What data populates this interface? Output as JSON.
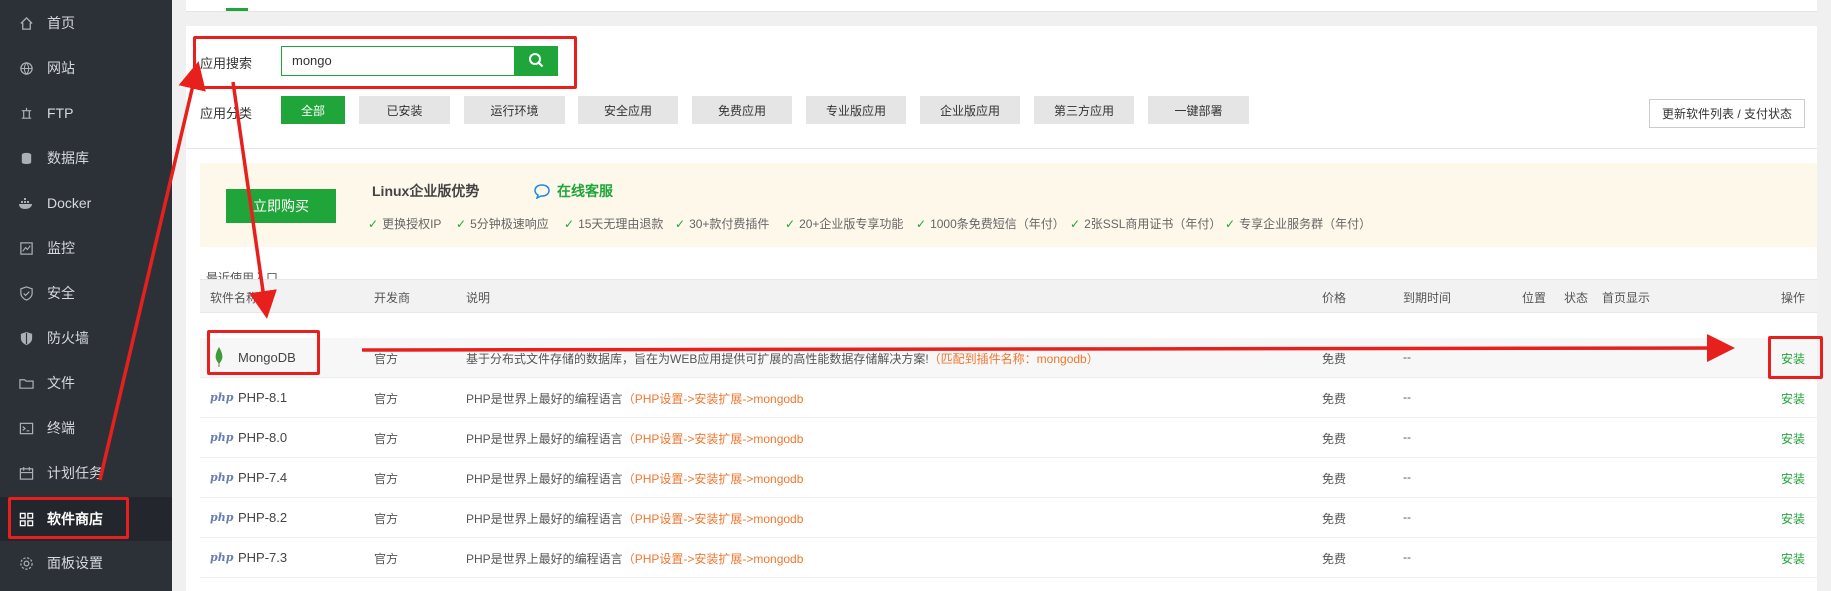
{
  "sidebar": {
    "items": [
      {
        "label": "首页",
        "icon": "home-icon"
      },
      {
        "label": "网站",
        "icon": "globe-icon"
      },
      {
        "label": "FTP",
        "icon": "ftp-icon"
      },
      {
        "label": "数据库",
        "icon": "database-icon"
      },
      {
        "label": "Docker",
        "icon": "docker-icon"
      },
      {
        "label": "监控",
        "icon": "monitor-icon"
      },
      {
        "label": "安全",
        "icon": "shield-icon"
      },
      {
        "label": "防火墙",
        "icon": "firewall-icon"
      },
      {
        "label": "文件",
        "icon": "folder-icon"
      },
      {
        "label": "终端",
        "icon": "terminal-icon"
      },
      {
        "label": "计划任务",
        "icon": "calendar-icon"
      },
      {
        "label": "软件商店",
        "icon": "grid-icon"
      },
      {
        "label": "面板设置",
        "icon": "gear-icon"
      }
    ],
    "active_index": 11
  },
  "search": {
    "label": "应用搜索",
    "value": "mongo"
  },
  "categories": {
    "label": "应用分类",
    "items": [
      "全部",
      "已安装",
      "运行环境",
      "安全应用",
      "免费应用",
      "专业版应用",
      "企业版应用",
      "第三方应用",
      "一键部署"
    ],
    "active_index": 0
  },
  "refresh_label": "更新软件列表 / 支付状态",
  "promo": {
    "buy_label": "立即购买",
    "title": "Linux企业版优势",
    "service_label": "在线客服",
    "features": [
      "更换授权IP",
      "5分钟极速响应",
      "15天无理由退款",
      "30+款付费插件",
      "20+企业版专享功能",
      "1000条免费短信（年付）",
      "2张SSL商用证书（年付）",
      "专享企业服务群（年付）"
    ]
  },
  "recent_label": "最近使用入口",
  "table": {
    "headers": {
      "name": "软件名称",
      "vendor": "开发商",
      "desc": "说明",
      "price": "价格",
      "expire": "到期时间",
      "position": "位置",
      "status": "状态",
      "home": "首页显示",
      "action": "操作"
    },
    "rows": [
      {
        "name": "MongoDB",
        "vendor": "官方",
        "desc": "基于分布式文件存储的数据库，旨在为WEB应用提供可扩展的高性能数据存储解决方案!",
        "hint": "（匹配到插件名称：mongodb）",
        "price": "免费",
        "expire": "--",
        "action": "安装"
      },
      {
        "name": "PHP-8.1",
        "vendor": "官方",
        "desc": "PHP是世界上最好的编程语言",
        "hint": "（PHP设置->安装扩展->mongodb",
        "price": "免费",
        "expire": "--",
        "action": "安装"
      },
      {
        "name": "PHP-8.0",
        "vendor": "官方",
        "desc": "PHP是世界上最好的编程语言",
        "hint": "（PHP设置->安装扩展->mongodb",
        "price": "免费",
        "expire": "--",
        "action": "安装"
      },
      {
        "name": "PHP-7.4",
        "vendor": "官方",
        "desc": "PHP是世界上最好的编程语言",
        "hint": "（PHP设置->安装扩展->mongodb",
        "price": "免费",
        "expire": "--",
        "action": "安装"
      },
      {
        "name": "PHP-8.2",
        "vendor": "官方",
        "desc": "PHP是世界上最好的编程语言",
        "hint": "（PHP设置->安装扩展->mongodb",
        "price": "免费",
        "expire": "--",
        "action": "安装"
      },
      {
        "name": "PHP-7.3",
        "vendor": "官方",
        "desc": "PHP是世界上最好的编程语言",
        "hint": "（PHP设置->安装扩展->mongodb",
        "price": "免费",
        "expire": "--",
        "action": "安装"
      }
    ],
    "php_logo_text": "php"
  },
  "colors": {
    "sidebar_bg": "#2c3138",
    "accent": "#20a53a",
    "hint_orange": "#f0772f",
    "annotation_red": "#e8201d"
  }
}
